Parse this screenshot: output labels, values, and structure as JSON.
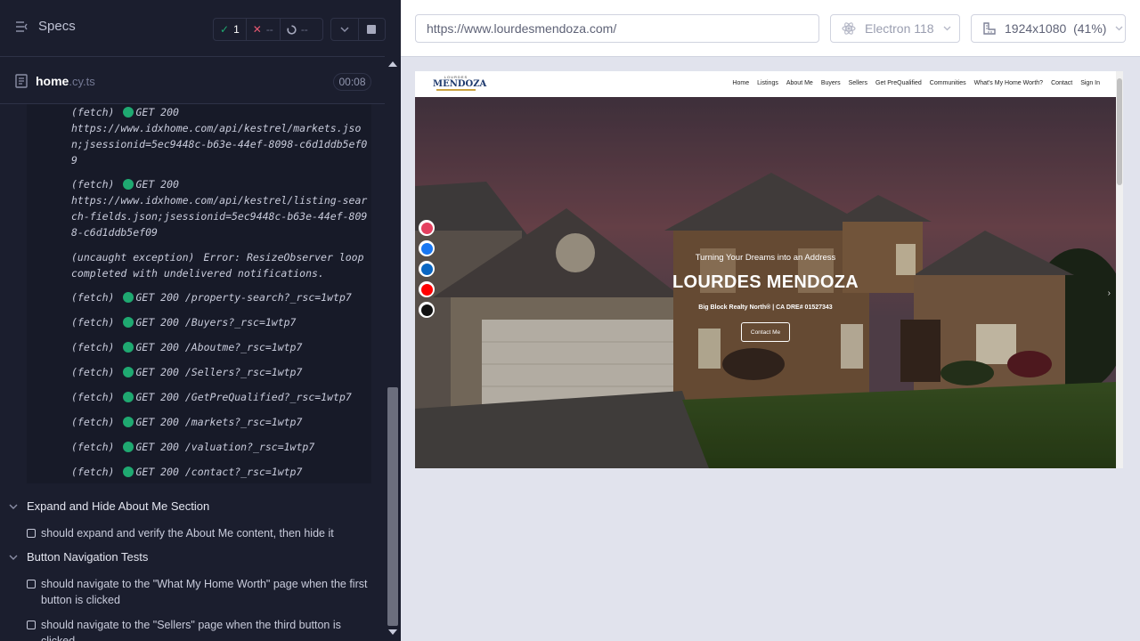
{
  "specs": {
    "title": "Specs",
    "passed": "1",
    "failed": "--",
    "pending": "--"
  },
  "file": {
    "name": "home",
    "ext": ".cy.ts",
    "duration": "00:08"
  },
  "logs": [
    {
      "type": "(fetch)",
      "status_dot": true,
      "text": "GET 200",
      "detail": "https://www.idxhome.com/api/kestrel/markets.json;jsessionid=5ec9448c-b63e-44ef-8098-c6d1ddb5ef09"
    },
    {
      "type": "(fetch)",
      "status_dot": true,
      "text": "GET 200",
      "detail": "https://www.idxhome.com/api/kestrel/listing-search-fields.json;jsessionid=5ec9448c-b63e-44ef-8098-c6d1ddb5ef09"
    },
    {
      "type": "(uncaught exception)",
      "status_dot": false,
      "text": "Error: ResizeObserver loop completed with undelivered notifications.",
      "detail": ""
    },
    {
      "type": "(fetch)",
      "status_dot": true,
      "text": "GET 200 /property-search?_rsc=1wtp7",
      "detail": ""
    },
    {
      "type": "(fetch)",
      "status_dot": true,
      "text": "GET 200 /Buyers?_rsc=1wtp7",
      "detail": ""
    },
    {
      "type": "(fetch)",
      "status_dot": true,
      "text": "GET 200 /Aboutme?_rsc=1wtp7",
      "detail": ""
    },
    {
      "type": "(fetch)",
      "status_dot": true,
      "text": "GET 200 /Sellers?_rsc=1wtp7",
      "detail": ""
    },
    {
      "type": "(fetch)",
      "status_dot": true,
      "text": "GET 200 /GetPreQualified?_rsc=1wtp7",
      "detail": ""
    },
    {
      "type": "(fetch)",
      "status_dot": true,
      "text": "GET 200 /markets?_rsc=1wtp7",
      "detail": ""
    },
    {
      "type": "(fetch)",
      "status_dot": true,
      "text": "GET 200 /valuation?_rsc=1wtp7",
      "detail": ""
    },
    {
      "type": "(fetch)",
      "status_dot": true,
      "text": "GET 200 /contact?_rsc=1wtp7",
      "detail": ""
    }
  ],
  "suites": [
    {
      "title": "Expand and Hide About Me Section",
      "tests": [
        "should expand and verify the About Me content, then hide it"
      ]
    },
    {
      "title": "Button Navigation Tests",
      "tests": [
        "should navigate to the \"What My Home Worth\" page when the first button is clicked",
        "should navigate to the \"Sellers\" page when the third button is clicked"
      ]
    }
  ],
  "browser": {
    "url": "https://www.lourdesmendoza.com/",
    "name": "Electron 118",
    "viewport": "1924x1080",
    "scale": "(41%)"
  },
  "site": {
    "logo_top": "LOURDES",
    "logo_main": "MENDOZA",
    "nav": [
      "Home",
      "Listings",
      "About Me",
      "Buyers",
      "Sellers",
      "Get PreQualified",
      "Communities",
      "What's My Home Worth?",
      "Contact",
      "Sign In"
    ],
    "hero_subtitle": "Turning Your Dreams into an Address",
    "hero_name": "LOURDES MENDOZA",
    "hero_info": "Big Block Realty North® | CA DRE# 01527343",
    "hero_button": "Contact Me",
    "social": [
      "instagram-icon",
      "facebook-icon",
      "linkedin-icon",
      "youtube-icon",
      "x-icon"
    ]
  },
  "colors": {
    "pass": "#1fa971",
    "fail": "#e45770",
    "panel_bg": "#1b1e2e"
  }
}
